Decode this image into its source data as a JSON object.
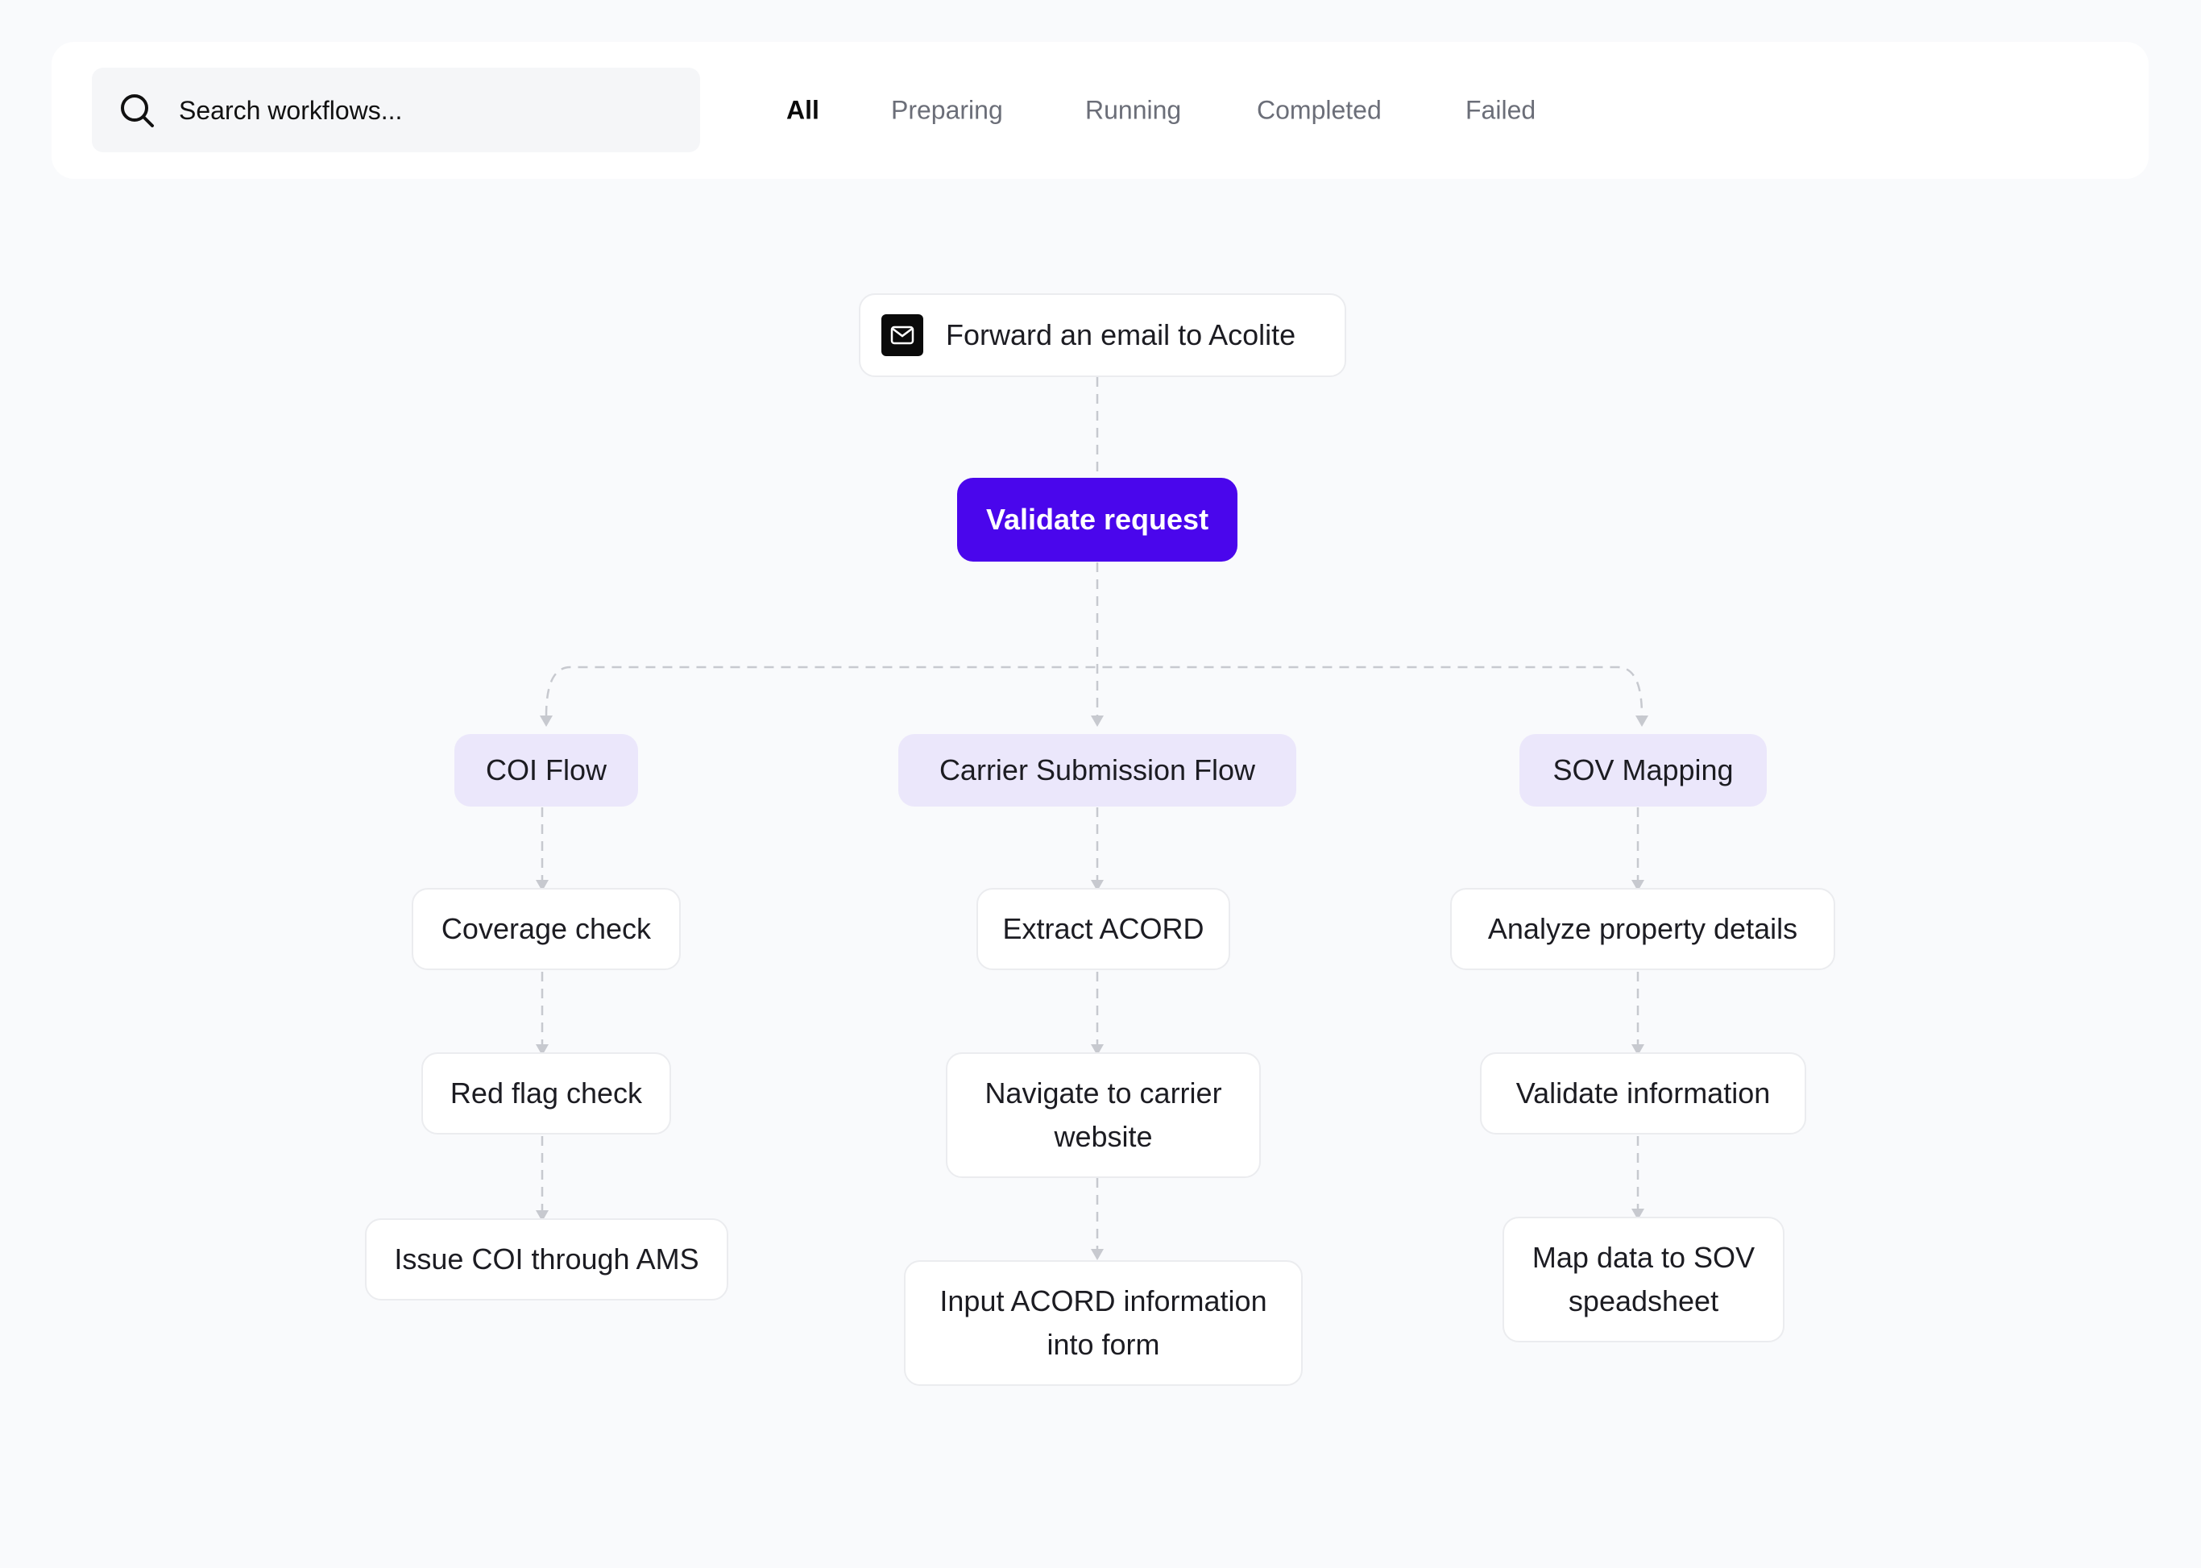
{
  "search": {
    "placeholder": "Search workflows..."
  },
  "tabs": [
    {
      "label": "All",
      "active": true
    },
    {
      "label": "Preparing",
      "active": false
    },
    {
      "label": "Running",
      "active": false
    },
    {
      "label": "Completed",
      "active": false
    },
    {
      "label": "Failed",
      "active": false
    }
  ],
  "workflow": {
    "trigger": {
      "label": "Forward an email to Acolite",
      "icon": "mail-icon"
    },
    "validate": {
      "label": "Validate request"
    },
    "branches": [
      {
        "label": "COI Flow",
        "steps": [
          "Coverage check",
          "Red flag check",
          "Issue COI through AMS"
        ]
      },
      {
        "label": "Carrier Submission Flow",
        "steps": [
          "Extract ACORD",
          "Navigate to carrier website",
          "Input ACORD information into form"
        ]
      },
      {
        "label": "SOV Mapping",
        "steps": [
          "Analyze property details",
          "Validate information",
          "Map data to SOV speadsheet"
        ]
      }
    ]
  },
  "colors": {
    "accent": "#4a06ec",
    "group_bg": "#ebe7fb",
    "connector": "#c7c9cf",
    "background": "#f9fafc"
  }
}
